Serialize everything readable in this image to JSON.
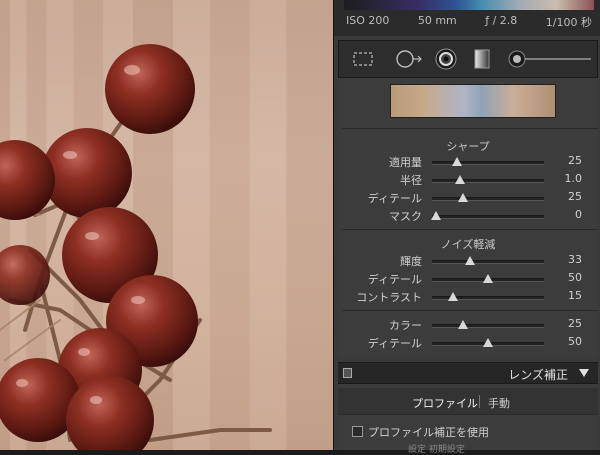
{
  "exif": {
    "iso": "ISO 200",
    "focal": "50 mm",
    "aperture": "ƒ / 2.8",
    "shutter": "1/100 秒"
  },
  "toolstrip": {
    "tools": [
      {
        "icon": "crop-overlay-icon"
      },
      {
        "icon": "spot-removal-icon"
      },
      {
        "icon": "red-eye-icon"
      },
      {
        "icon": "graduated-filter-icon"
      },
      {
        "icon": "adjustment-brush-icon"
      }
    ]
  },
  "sharpening": {
    "title": "シャープ",
    "rows": [
      {
        "label": "適用量",
        "value": "25",
        "pos": 0.22
      },
      {
        "label": "半径",
        "value": "1.0",
        "pos": 0.25
      },
      {
        "label": "ディテール",
        "value": "25",
        "pos": 0.28
      },
      {
        "label": "マスク",
        "value": "0",
        "pos": 0.04
      }
    ]
  },
  "noise_reduction": {
    "title": "ノイズ軽減",
    "rows": [
      {
        "label": "輝度",
        "value": "33",
        "pos": 0.34
      },
      {
        "label": "ディテール",
        "value": "50",
        "pos": 0.5
      },
      {
        "label": "コントラスト",
        "value": "15",
        "pos": 0.19
      }
    ],
    "color_rows": [
      {
        "label": "カラー",
        "value": "25",
        "pos": 0.28
      },
      {
        "label": "ディテール",
        "value": "50",
        "pos": 0.5
      }
    ]
  },
  "lens": {
    "title": "レンズ補正",
    "tab_profile": "プロファイル",
    "tab_manual": "手動",
    "enable_profile": "プロファイル補正を使用",
    "partial": "設定   初期設定"
  }
}
